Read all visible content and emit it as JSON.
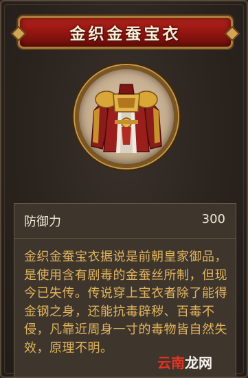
{
  "item": {
    "name": "金织金蚕宝衣",
    "icon": "robe-armor-icon",
    "stats": [
      {
        "label": "防御力",
        "value": "300"
      }
    ],
    "description": "金织金蚕宝衣据说是前朝皇家御品，是使用含有剧毒的金蚕丝所制，但现今已失传。传说穿上宝衣者除了能得金钢之身，还能抗毒辟秽、百毒不侵，凡靠近周身一寸的毒物皆自然失效，原理不明。"
  },
  "watermark": {
    "part1": "云南",
    "part2": "龙网"
  },
  "colors": {
    "banner": "#8e1510",
    "description_text": "#e2b55c",
    "stat_text": "#efe6d6"
  }
}
